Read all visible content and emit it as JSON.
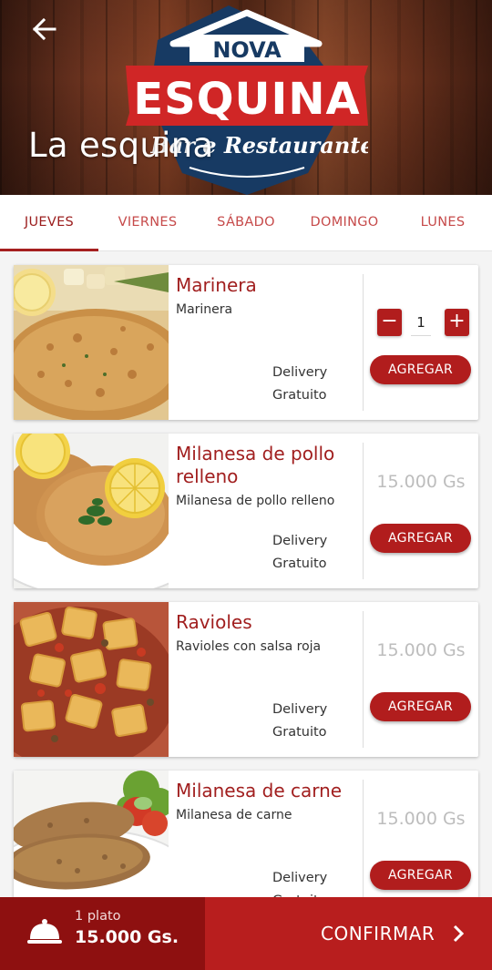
{
  "header": {
    "title": "La esquina",
    "logo": {
      "line1": "NOVA",
      "line2": "ESQUINA",
      "line3": "Bar e Restaurante"
    },
    "back_icon": "arrow-left-icon"
  },
  "tabs": [
    {
      "label": "JUEVES",
      "active": true
    },
    {
      "label": "VIERNES",
      "active": false
    },
    {
      "label": "SÁBADO",
      "active": false
    },
    {
      "label": "DOMINGO",
      "active": false
    },
    {
      "label": "LUNES",
      "active": false
    }
  ],
  "items": [
    {
      "name": "Marinera",
      "description": "Marinera",
      "delivery_line1": "Delivery",
      "delivery_line2": "Gratuito",
      "quantity": "1",
      "minus": "−",
      "plus": "+",
      "button": "AGREGAR"
    },
    {
      "name": "Milanesa de pollo relleno",
      "description": "Milanesa de pollo relleno",
      "price": "15.000 Gs",
      "delivery_line1": "Delivery",
      "delivery_line2": "Gratuito",
      "button": "AGREGAR"
    },
    {
      "name": "Ravioles",
      "description": "Ravioles con salsa roja",
      "price": "15.000 Gs",
      "delivery_line1": "Delivery",
      "delivery_line2": "Gratuito",
      "button": "AGREGAR"
    },
    {
      "name": "Milanesa de carne",
      "description": "Milanesa de carne",
      "price": "15.000 Gs",
      "delivery_line1": "Delivery",
      "delivery_line2": "Gratuito",
      "button": "AGREGAR"
    }
  ],
  "cart": {
    "plates": "1 plato",
    "total": "15.000 Gs.",
    "confirm": "CONFIRMAR",
    "icon": "cloche-icon"
  },
  "colors": {
    "accent": "#b11d1d",
    "dark_accent": "#8e1010",
    "tab_text": "#c64a4a",
    "price_text": "#bdbdbd"
  }
}
